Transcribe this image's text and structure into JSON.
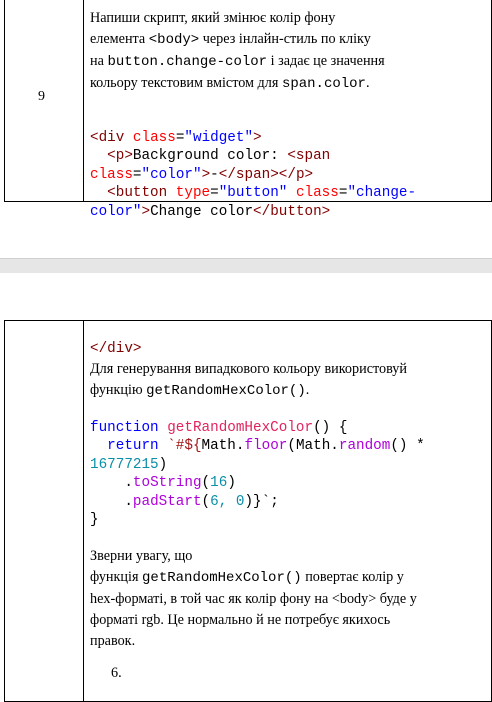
{
  "row9": {
    "number": "9",
    "task_line1": "Напиши скрипт, який змінює колір фону",
    "task_line2_a": "елемента ",
    "task_line2_b": "<body>",
    "task_line2_c": " через інлайн-стиль по кліку",
    "task_line3_a": "на ",
    "task_line3_b": "button.change-color",
    "task_line3_c": " і задає це значення",
    "task_line4_a": "кольору текстовим вмістом для ",
    "task_line4_b": "span.color",
    "task_line4_c": ".",
    "code": {
      "l1_open": "<div ",
      "l1_attr": "class",
      "l1_eq": "=",
      "l1_val": "\"widget\"",
      "l1_close": ">",
      "l2_a": "  <p>",
      "l2_b": "Background color: ",
      "l2_c": "<span",
      "l3_attr": "class",
      "l3_eq": "=",
      "l3_val": "\"color\"",
      "l3_b": ">",
      "l3_c": "-",
      "l3_d": "</span></p>",
      "l4_a": "  <button ",
      "l4_attr1": "type",
      "l4_eq1": "=",
      "l4_val1": "\"button\"",
      "l4_attr2": " class",
      "l4_eq2": "=",
      "l4_val2": "\"change-",
      "l5_val2": "color\"",
      "l5_b": ">",
      "l5_c": "Change color",
      "l5_d": "</button>"
    }
  },
  "row_cont": {
    "code_close": "</div>",
    "para1_a": "Для генерування випадкового кольору використовуй",
    "para1_b": "функцію ",
    "para1_c": "getRandomHexColor()",
    "para1_d": ".",
    "js": {
      "l1_kw": "function ",
      "l1_fn": "getRandomHexColor",
      "l1_rest": "() {",
      "l2_kw": "  return ",
      "l2_str": "`#${",
      "l2_obj": "Math.",
      "l2_fn": "floor",
      "l2_p": "(",
      "l2_obj2": "Math.",
      "l2_fn2": "random",
      "l2_rest": "() *",
      "l3_num": "16777215",
      "l3_rest": ")",
      "l4_dot": "    .",
      "l4_fn": "toString",
      "l4_p": "(",
      "l4_num": "16",
      "l4_end": ")",
      "l5_dot": "    .",
      "l5_fn": "padStart",
      "l5_p": "(",
      "l5_num": "6, 0",
      "l5_end": ")}`;",
      "l6": "}"
    },
    "para2_a": "Зверни увагу, що",
    "para2_b": "функція ",
    "para2_c": "getRandomHexColor()",
    "para2_d": " повертає колір у",
    "para2_e": "hex-форматі, в той час як колір фону на <body> буде у",
    "para2_f": "форматі rgb. Це нормально й не потребує якихось",
    "para2_g": "правок.",
    "next_item": "6."
  }
}
